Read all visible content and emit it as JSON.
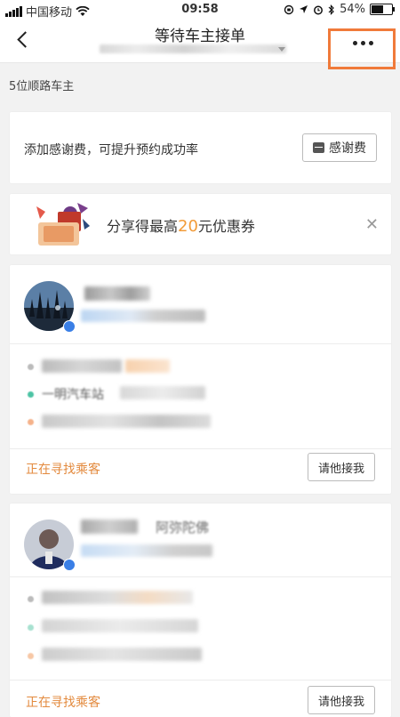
{
  "status_bar": {
    "carrier": "中国移动",
    "time": "09:58",
    "battery": "54%",
    "battery_level": 0.54
  },
  "nav": {
    "title": "等待车主接单",
    "back_icon": "chevron-left-icon",
    "more_icon": "more-horizontal-icon",
    "highlight_color": "#f07a3a"
  },
  "driver_count": "5位顺路车主",
  "tip_card": {
    "text": "添加感谢费，可提升预约成功率",
    "button_label": "感谢费",
    "button_icon": "wallet-icon"
  },
  "coupon": {
    "text_prefix": "分享得最高",
    "amount": "20",
    "text_suffix": "元优惠券",
    "close_icon": "close-icon",
    "illustration": "coupon-illustration"
  },
  "drivers": [
    {
      "station": "一明汽车站",
      "status": "正在寻找乘客",
      "invite_label": "请他接我"
    },
    {
      "name_fragment": "阿弥陀佛",
      "status": "正在寻找乘客",
      "invite_label": "请他接我"
    }
  ],
  "colors": {
    "accent_orange": "#e38a3e",
    "coupon_amount": "#f29b38",
    "badge_blue": "#3a7fe6"
  }
}
